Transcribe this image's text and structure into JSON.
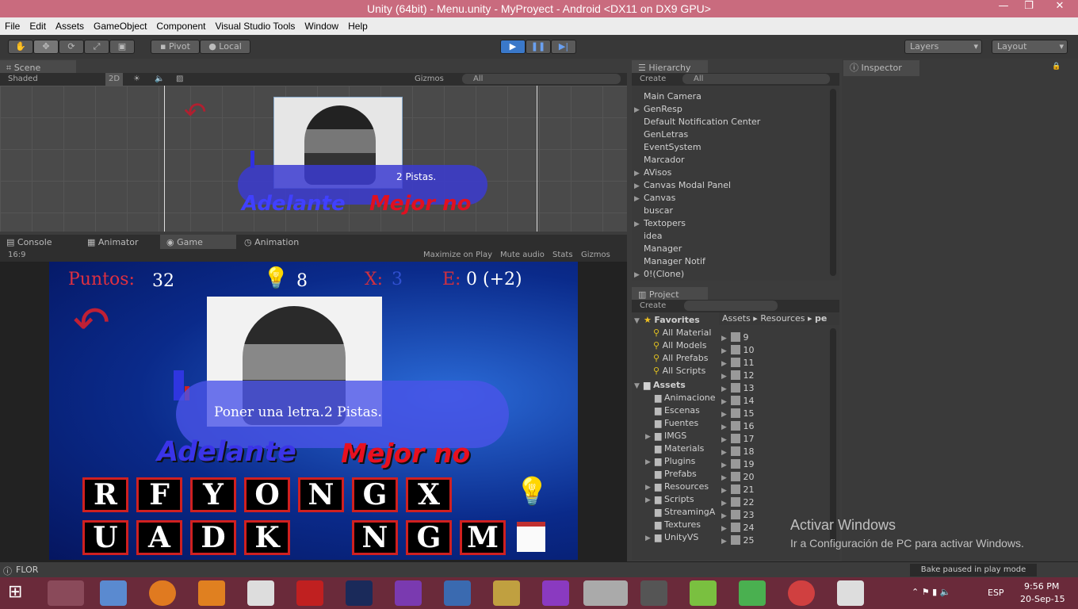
{
  "window": {
    "title": "Unity (64bit) - Menu.unity - MyProyect - Android <DX11 on DX9 GPU>"
  },
  "menu": [
    "File",
    "Edit",
    "Assets",
    "GameObject",
    "Component",
    "Visual Studio Tools",
    "Window",
    "Help"
  ],
  "toolbar": {
    "pivot": "Pivot",
    "local": "Local",
    "layers": "Layers",
    "layout": "Layout"
  },
  "scene": {
    "tab": "Scene",
    "shaded": "Shaded",
    "mode2d": "2D",
    "gizmos": "Gizmos",
    "search": "All",
    "pistas": "2 Pistas.",
    "adelante": "Adelante",
    "mejor": "Mejor no"
  },
  "bottomTabs": {
    "console": "Console",
    "animator": "Animator",
    "game": "Game",
    "animation": "Animation"
  },
  "gameBar": {
    "aspect": "16:9",
    "maximize": "Maximize on Play",
    "mute": "Mute audio",
    "stats": "Stats",
    "gizmos": "Gizmos"
  },
  "game": {
    "puntosLabel": "Puntos:",
    "puntos": "32",
    "bulbs": "8",
    "xLabel": "X:",
    "x": "3",
    "eLabel": "E:",
    "e": "0 (+2)",
    "hint": "Poner una letra.2 Pistas.",
    "adelante": "Adelante",
    "mejor": "Mejor no",
    "row1": [
      "R",
      "F",
      "Y",
      "O",
      "N",
      "G",
      "X"
    ],
    "row2": [
      "U",
      "A",
      "D",
      "K",
      "",
      "N",
      "G",
      "M"
    ]
  },
  "hierarchy": {
    "tab": "Hierarchy",
    "create": "Create",
    "search": "All",
    "items": [
      {
        "n": "Main Camera",
        "a": false
      },
      {
        "n": "GenResp",
        "a": true
      },
      {
        "n": "Default Notification Center",
        "a": false
      },
      {
        "n": "GenLetras",
        "a": false
      },
      {
        "n": "EventSystem",
        "a": false
      },
      {
        "n": "Marcador",
        "a": false
      },
      {
        "n": "AVisos",
        "a": true
      },
      {
        "n": "Canvas Modal Panel",
        "a": true
      },
      {
        "n": "Canvas",
        "a": true
      },
      {
        "n": "buscar",
        "a": false
      },
      {
        "n": "Textopers",
        "a": true
      },
      {
        "n": "idea",
        "a": false
      },
      {
        "n": "Manager",
        "a": false
      },
      {
        "n": "Manager Notif",
        "a": false
      },
      {
        "n": "0!(Clone)",
        "a": true
      }
    ]
  },
  "inspector": {
    "tab": "Inspector"
  },
  "project": {
    "tab": "Project",
    "create": "Create",
    "favorites": "Favorites",
    "favs": [
      "All Material",
      "All Models",
      "All Prefabs",
      "All Scripts"
    ],
    "assets": "Assets",
    "folders": [
      "Animacione",
      "Escenas",
      "Fuentes",
      "IMGS",
      "Materials",
      "Plugins",
      "Prefabs",
      "Resources",
      "Scripts",
      "StreamingA",
      "Textures",
      "UnityVS"
    ],
    "crumb": [
      "Assets",
      "Resources",
      "pe"
    ],
    "files": [
      "9",
      "10",
      "11",
      "12",
      "13",
      "14",
      "15",
      "16",
      "17",
      "18",
      "19",
      "20",
      "21",
      "22",
      "23",
      "24",
      "25"
    ]
  },
  "watermark": {
    "line1": "Activar Windows",
    "line2": "Ir a Configuración de PC para activar Windows."
  },
  "status": {
    "left": "FLOR",
    "right": "Bake paused in play mode"
  },
  "taskbar": {
    "lang": "ESP",
    "time": "9:56 PM",
    "date": "20-Sep-15"
  },
  "colors": {
    "title": "#c96b7e",
    "taskbar": "#6a2a3a",
    "play": "#3a78c9",
    "tileBorder": "#d02020",
    "puntos": "#e03040",
    "x": "#d03040"
  }
}
